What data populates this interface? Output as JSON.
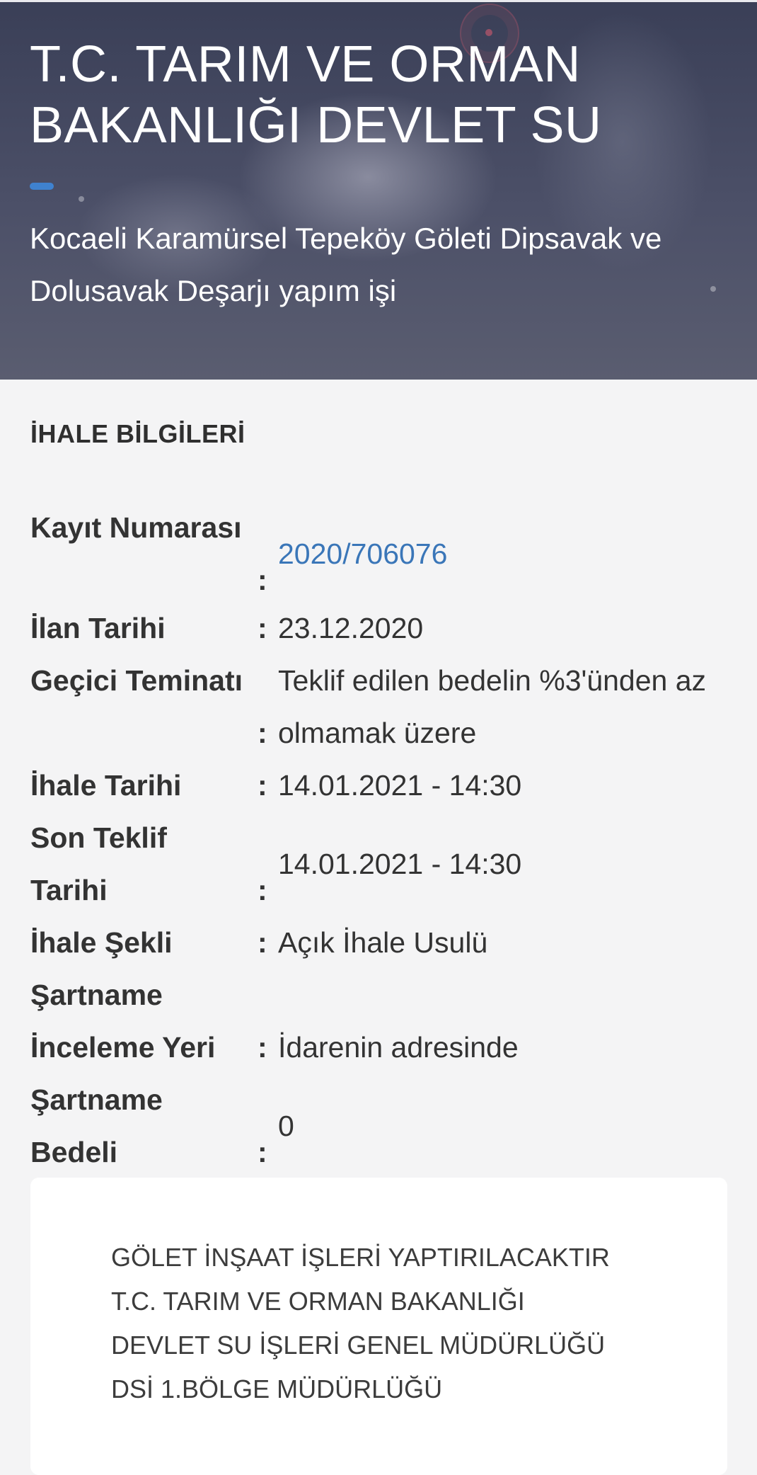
{
  "header": {
    "title": "T.C. TARIM VE ORMAN BAKANLIĞI DEVLET SU",
    "subtitle": "Kocaeli Karamürsel Tepeköy Göleti Dipsavak ve Dolusavak Deşarjı yapım işi"
  },
  "section": {
    "title": "İHALE BİLGİLERİ"
  },
  "info": {
    "kayit_label": "Kayıt Numarası",
    "kayit_value": "2020/706076",
    "ilan_label": "İlan Tarihi",
    "ilan_value": "23.12.2020",
    "teminat_label": "Geçici Teminatı",
    "teminat_value": "Teklif edilen bedelin %3'ünden az olmamak üzere",
    "ihale_tarihi_label": "İhale Tarihi",
    "ihale_tarihi_value": "14.01.2021 - 14:30",
    "son_teklif_label": "Son Teklif Tarihi",
    "son_teklif_value": "14.01.2021 - 14:30",
    "ihale_sekli_label": "İhale Şekli",
    "ihale_sekli_value": "Açık İhale Usulü",
    "inceleme_label": "Şartname İnceleme Yeri",
    "inceleme_value": "İdarenin adresinde",
    "bedel_label": "Şartname Bedeli",
    "bedel_value": "0",
    "colon": ":"
  },
  "card": {
    "text": "GÖLET İNŞAAT İŞLERİ YAPTIRILACAKTIR\nT.C. TARIM VE ORMAN BAKANLIĞI\nDEVLET SU İŞLERİ GENEL MÜDÜRLÜĞÜ\nDSİ 1.BÖLGE MÜDÜRLÜĞÜ"
  },
  "colors": {
    "accent": "#3f82cf",
    "link": "#3a76b8",
    "background": "#f4f4f5"
  }
}
